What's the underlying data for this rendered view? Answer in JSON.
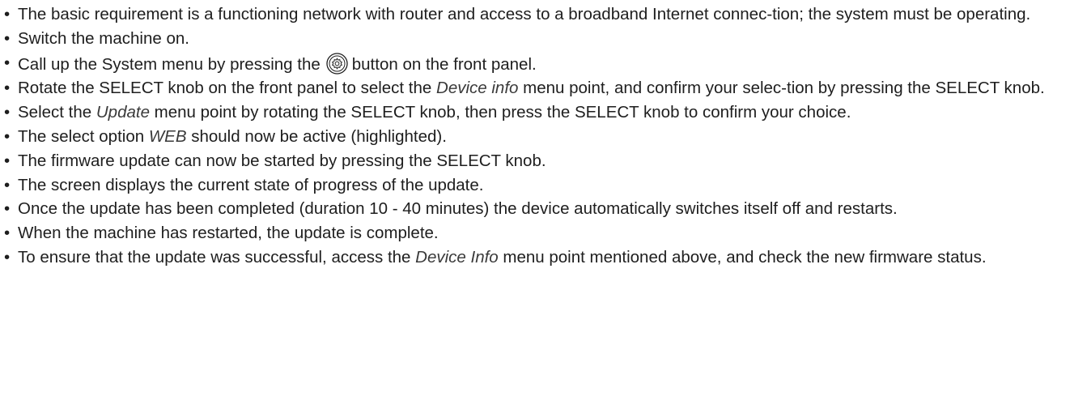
{
  "items": [
    {
      "text": "The basic requirement is a functioning network with router and access to a broadband Internet connec-tion; the system must be operating."
    },
    {
      "text": "Switch the machine on."
    },
    {
      "before": "Call up the System menu by pressing the",
      "icon": "gear-button-icon",
      "after": "button on the front panel."
    },
    {
      "before": "Rotate the SELECT knob on the front panel to select the ",
      "term": "Device info",
      "after": " menu point, and confirm your selec-tion by pressing the SELECT knob."
    },
    {
      "before": "Select the ",
      "term": "Update",
      "after": " menu point by rotating the SELECT knob, then press the SELECT knob to confirm your choice."
    },
    {
      "before": "The select option ",
      "term": "WEB",
      "after": " should now be active (highlighted)."
    },
    {
      "text": "The firmware update can now be started by pressing the SELECT knob."
    },
    {
      "text": "The screen displays the current state of progress of the update."
    },
    {
      "text": "Once the update has been completed (duration 10 - 40 minutes) the device automatically switches itself off and restarts."
    },
    {
      "text": "When the machine has restarted, the update is complete."
    },
    {
      "before": "To ensure that the update was successful, access the ",
      "term": "Device Info",
      "after": " menu point mentioned above, and check the new firmware status."
    }
  ],
  "colors": {
    "text": "#1e1e1e",
    "term": "#3a3a3a"
  }
}
